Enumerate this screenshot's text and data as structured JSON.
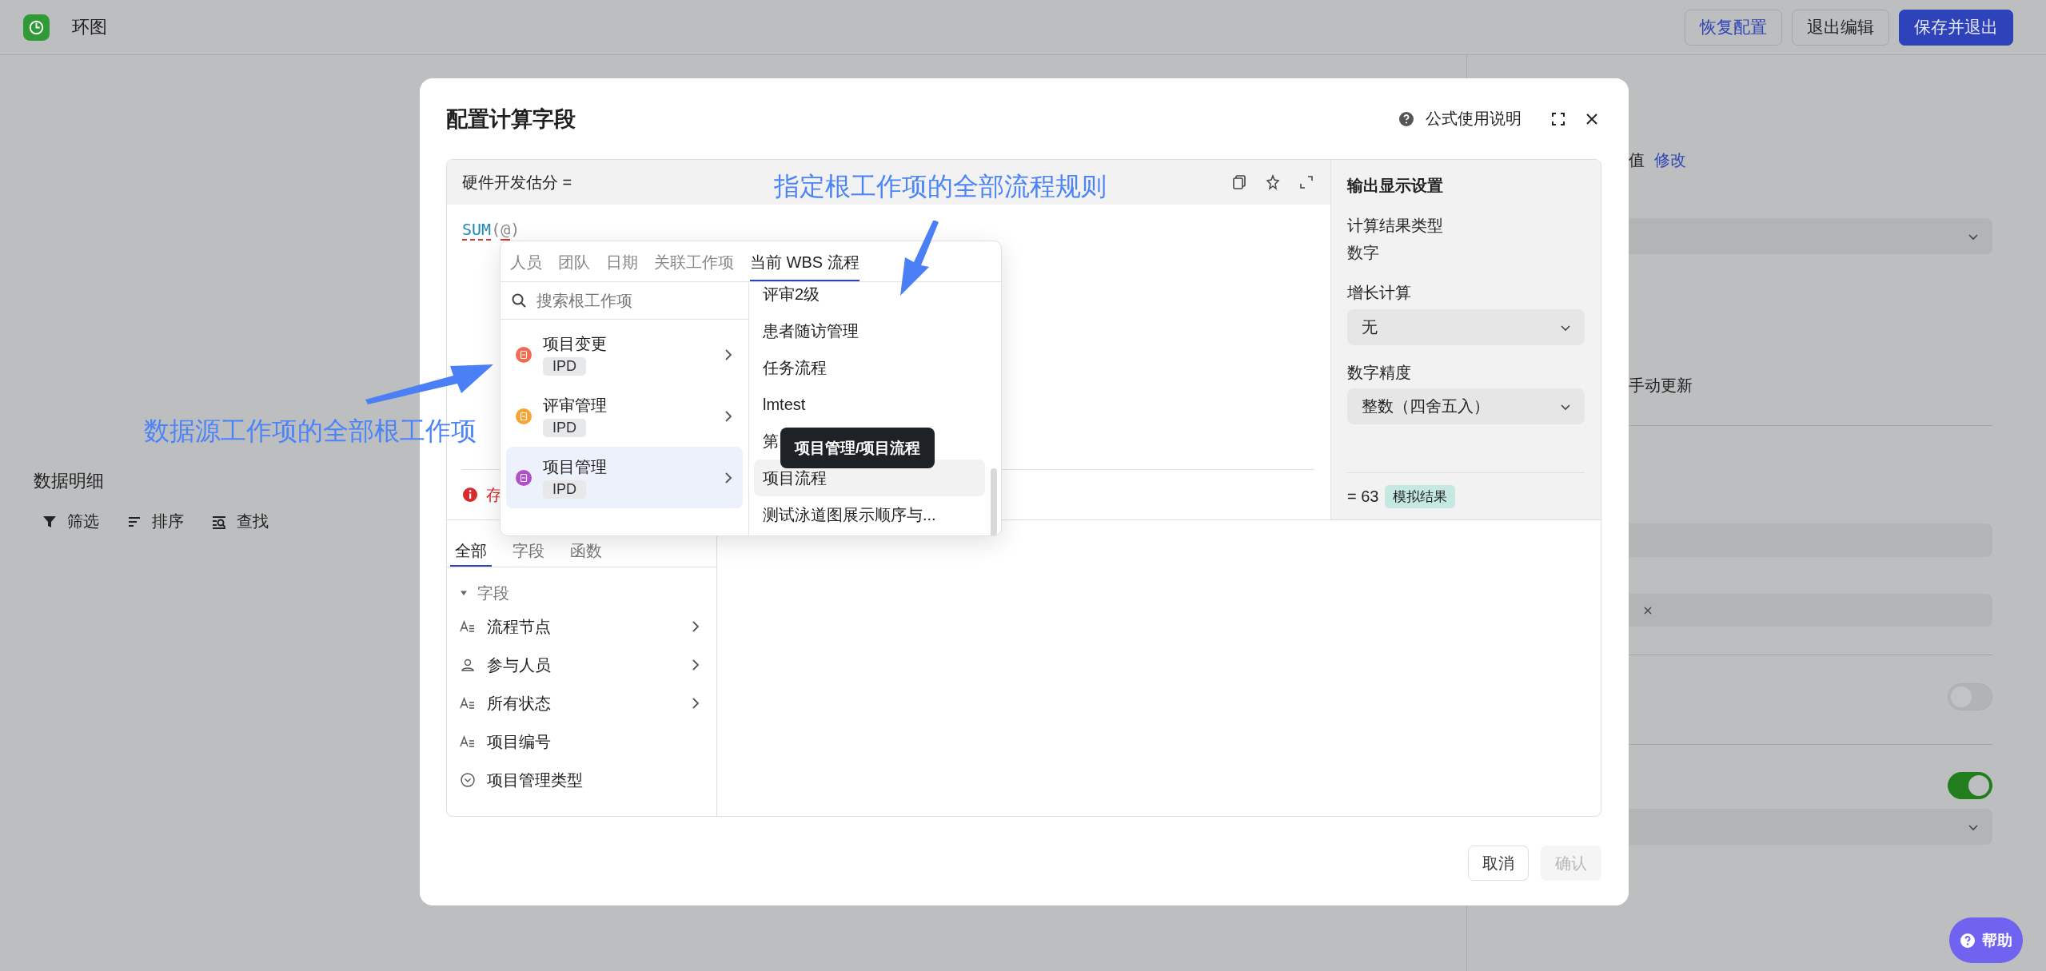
{
  "topbar": {
    "title": "环图",
    "buttons": [
      {
        "label": "恢复配置",
        "kind": "link"
      },
      {
        "label": "退出编辑",
        "kind": "default"
      },
      {
        "label": "保存并退出",
        "kind": "primary"
      }
    ]
  },
  "left": {
    "section_title": "数据明细",
    "tools": [
      {
        "label": "筛选",
        "kind": "filter"
      },
      {
        "label": "排序",
        "kind": "sort"
      },
      {
        "label": "查找",
        "kind": "find"
      }
    ]
  },
  "right_panel": {
    "value_label": "值",
    "edit_link": "修改",
    "manual_update": "手动更新",
    "toggles": [
      {
        "on": false
      },
      {
        "on": true
      }
    ]
  },
  "modal": {
    "title": "配置计算字段",
    "help_link": "公式使用说明",
    "editor": {
      "field_name": "硬件开发估分 =",
      "code": [
        {
          "text": "SUM",
          "kind": "function"
        },
        {
          "text": "(",
          "kind": "punct"
        },
        {
          "text": "@",
          "kind": "error"
        },
        {
          "text": ")",
          "kind": "punct"
        }
      ],
      "error_text": "存"
    },
    "picker": {
      "tabs": [
        {
          "label": "人员",
          "selected": false
        },
        {
          "label": "团队",
          "selected": false
        },
        {
          "label": "日期",
          "selected": false
        },
        {
          "label": "关联工作项",
          "selected": false
        },
        {
          "label": "当前 WBS 流程",
          "selected": true
        }
      ],
      "search": {
        "placeholder": "搜索根工作项"
      },
      "items": [
        {
          "name": "项目变更",
          "tag": "IPD",
          "color": "#f26b50",
          "selected": false
        },
        {
          "name": "评审管理",
          "tag": "IPD",
          "color": "#f7a335",
          "selected": false
        },
        {
          "name": "项目管理",
          "tag": "IPD",
          "color": "#b24fca",
          "selected": true
        }
      ],
      "processes": [
        {
          "name": "评审2级",
          "selected": false
        },
        {
          "name": "患者随访管理",
          "selected": false
        },
        {
          "name": "任务流程",
          "selected": false
        },
        {
          "name": "lmtest",
          "selected": false
        },
        {
          "name": "第",
          "selected": false
        },
        {
          "name": "项目流程",
          "selected": true
        },
        {
          "name": "测试泳道图展示顺序与...",
          "selected": false
        }
      ],
      "tooltip": "项目管理/项目流程"
    },
    "output": {
      "heading": "输出显示设置",
      "result_type_label": "计算结果类型",
      "result_type": "数字",
      "growth_label": "增长计算",
      "growth_value": "无",
      "precision_label": "数字精度",
      "precision_value": "整数（四舍五入）",
      "result": "= 63",
      "result_badge": "模拟结果"
    },
    "field_tabs": [
      {
        "label": "全部",
        "selected": true
      },
      {
        "label": "字段",
        "selected": false
      },
      {
        "label": "函数",
        "selected": false
      }
    ],
    "field_group": {
      "label": "字段",
      "expanded": true,
      "children": [
        {
          "name": "流程节点",
          "kind": "text",
          "has_submenu": true
        },
        {
          "name": "参与人员",
          "kind": "person",
          "has_submenu": true
        },
        {
          "name": "所有状态",
          "kind": "text",
          "has_submenu": true
        },
        {
          "name": "项目编号",
          "kind": "text",
          "has_submenu": false
        },
        {
          "name": "项目管理类型",
          "kind": "select",
          "has_submenu": false
        }
      ]
    },
    "buttons": [
      {
        "label": "取消",
        "disabled": false
      },
      {
        "label": "确认",
        "disabled": true
      }
    ]
  },
  "annotations": [
    {
      "text": "数据源工作项的全部根工作项",
      "kind": "left"
    },
    {
      "text": "指定根工作项的全部流程规则",
      "kind": "top"
    }
  ],
  "help_button": {
    "label": "帮助"
  }
}
